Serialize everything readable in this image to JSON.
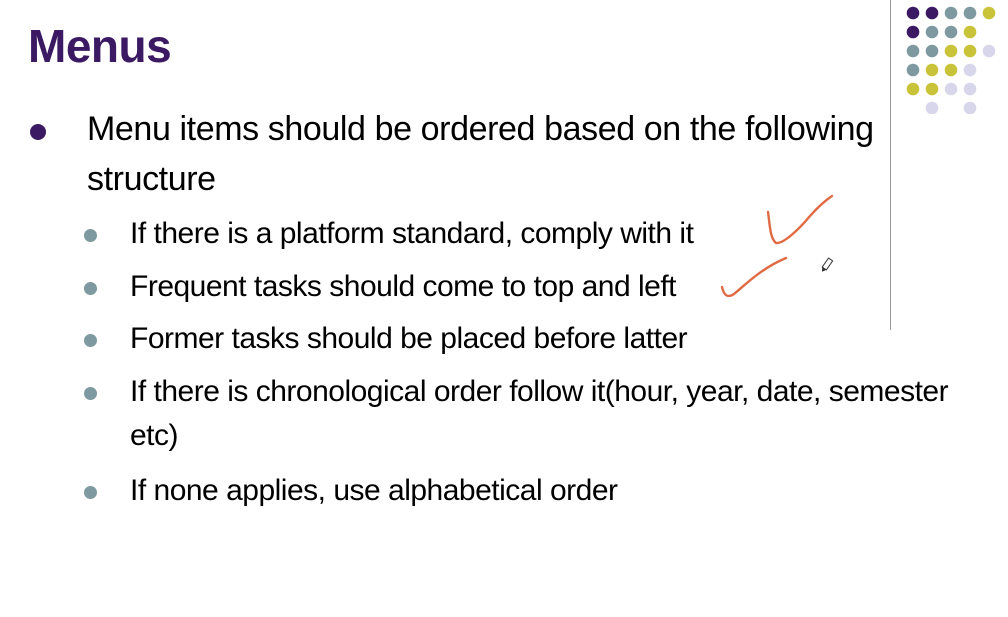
{
  "slide": {
    "title": "Menus",
    "main_bullet": "Menu items should be ordered based on the following structure",
    "sub_bullets": [
      "If there is a platform standard, comply with it",
      "Frequent tasks should come to top and left",
      "Former tasks should be placed before latter",
      "If there is chronological order follow it(hour, year, date, semester etc)",
      "If none applies, use alphabetical order"
    ]
  },
  "colors": {
    "title": "#3b1a63",
    "main_bullet": "#3b1a63",
    "sub_bullet": "#7e9aa0",
    "annotation": "#e06a44",
    "dot_purple": "#3b1a63",
    "dot_teal": "#7e9aa0",
    "dot_yellow": "#c9c33a",
    "dot_lavender": "#d8d6ea"
  },
  "icons": {
    "annotations": [
      "checkmark-icon",
      "checkmark-icon",
      "pen-cursor-icon"
    ]
  }
}
